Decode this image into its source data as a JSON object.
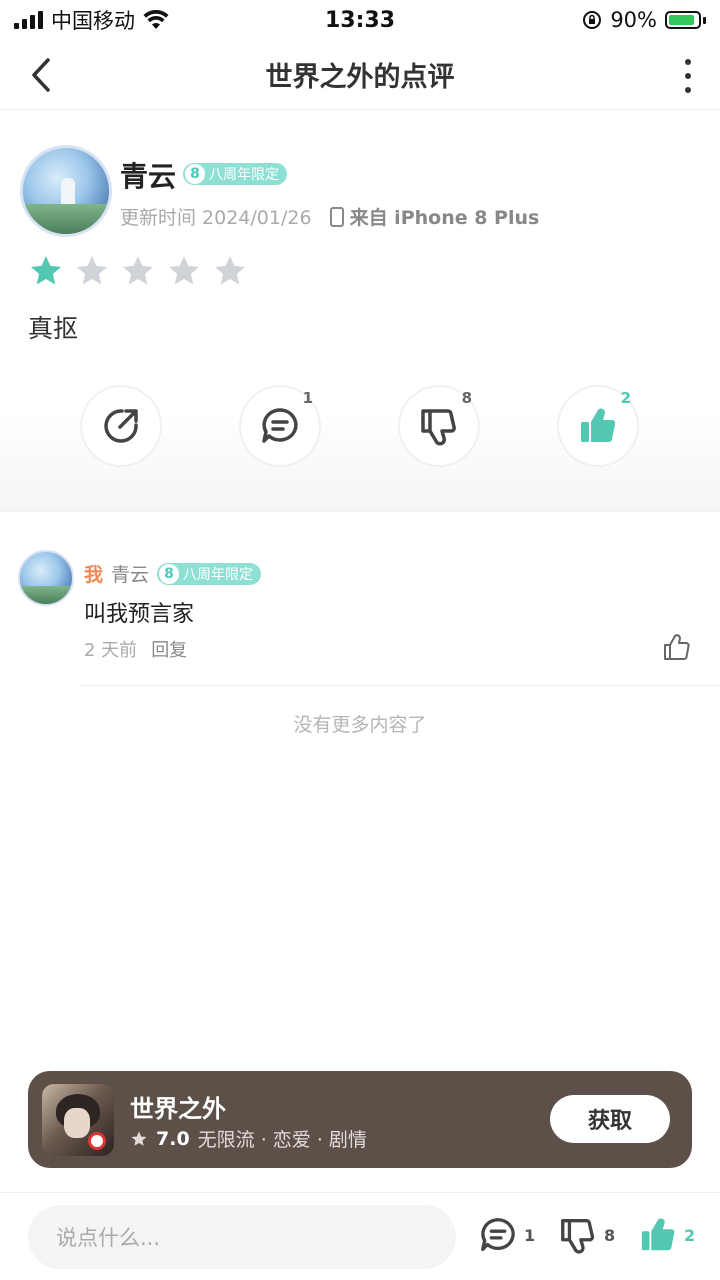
{
  "status_bar": {
    "carrier": "中国移动",
    "time": "13:33",
    "battery": "90%"
  },
  "nav": {
    "title": "世界之外的点评"
  },
  "review": {
    "user_name": "青云",
    "badge_num": "8",
    "badge_label": "八周年限定",
    "updated": "更新时间 2024/01/26",
    "device": "来自 iPhone 8 Plus",
    "rating": 1,
    "rating_max": 5,
    "text": "真抠",
    "actions": {
      "comment_count": "1",
      "dislike_count": "8",
      "like_count": "2"
    }
  },
  "comment": {
    "me_tag": "我",
    "user_name": "青云",
    "badge_num": "8",
    "badge_label": "八周年限定",
    "text": "叫我预言家",
    "time": "2 天前",
    "reply_label": "回复"
  },
  "no_more": "没有更多内容了",
  "game_card": {
    "name": "世界之外",
    "score": "7.0",
    "tags": "无限流 · 恋爱 · 剧情",
    "button": "获取"
  },
  "bottom_bar": {
    "placeholder": "说点什么...",
    "comment_count": "1",
    "dislike_count": "8",
    "like_count": "2"
  },
  "colors": {
    "accent": "#52c8b2",
    "star_empty": "#d0d3d8",
    "card_bg": "#5c5049",
    "me_tag": "#f08a55"
  }
}
